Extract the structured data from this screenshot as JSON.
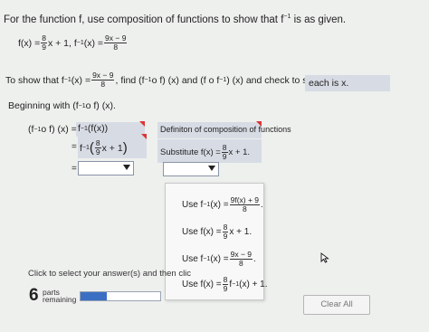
{
  "question": {
    "prefix": "For the function f, use composition of functions to show that f",
    "sup": "−1",
    "suffix": " is as given."
  },
  "given": {
    "f_lhs": "f(x) =",
    "f_num": "8",
    "f_den": "9",
    "f_rest": "x + 1, f",
    "inv_sup": "−1",
    "finv_lhs": "(x) =",
    "finv_num": "9x − 9",
    "finv_den": "8"
  },
  "instruction": {
    "a": "To show that f",
    "sup1": "−1",
    "b": "(x) =",
    "num": "9x − 9",
    "den": "8",
    "c": ", find (f",
    "sup2": "−1",
    "d": "o f) (x) and (f o f",
    "sup3": "−1",
    "e": ") (x) and check to see that",
    "answer_box": "each is x."
  },
  "begin": {
    "a": "Beginning with (f",
    "sup": "−1",
    "b": "o f) (x)."
  },
  "work": {
    "line1_lhs": "(f",
    "line1_sup": "−1",
    "line1_mid": "o f) (x) =",
    "line1_rhs": "f",
    "line1_rhs_sup": "−1",
    "line1_rhs_end": "(f(x))",
    "line2_eq": "=",
    "line2_f": "f",
    "line2_sup": "−1",
    "line2_num": "8",
    "line2_den": "9",
    "line2_end": "x + 1",
    "line3_eq": "="
  },
  "reasons": {
    "r1": "Definiton of composition of functions",
    "r2_a": "Substitute f(x) =",
    "r2_num": "8",
    "r2_den": "9",
    "r2_b": "x + 1."
  },
  "options": [
    {
      "a": "Use f",
      "sup": "−1",
      "b": "(x) =",
      "num": "9f(x) + 9",
      "den": "8",
      "c": "."
    },
    {
      "a": "Use f(x) =",
      "num": "8",
      "den": "9",
      "c": "x + 1."
    },
    {
      "a": "Use f",
      "sup": "−1",
      "b": "(x) =",
      "num": "9x − 9",
      "den": "8",
      "c": "."
    },
    {
      "a": "Use f(x) =",
      "num": "8",
      "den": "9",
      "c": "f",
      "sup2": "−1",
      "d": "(x) + 1."
    }
  ],
  "footer": {
    "hint": "Click to select your answer(s) and then clic",
    "parts_count": "6",
    "parts_label1": "parts",
    "parts_label2": "remaining",
    "progress": 0.33,
    "clear_all": "Clear All"
  },
  "colors": {
    "progress": "#3a6fc4",
    "red_mark": "#d33333"
  }
}
